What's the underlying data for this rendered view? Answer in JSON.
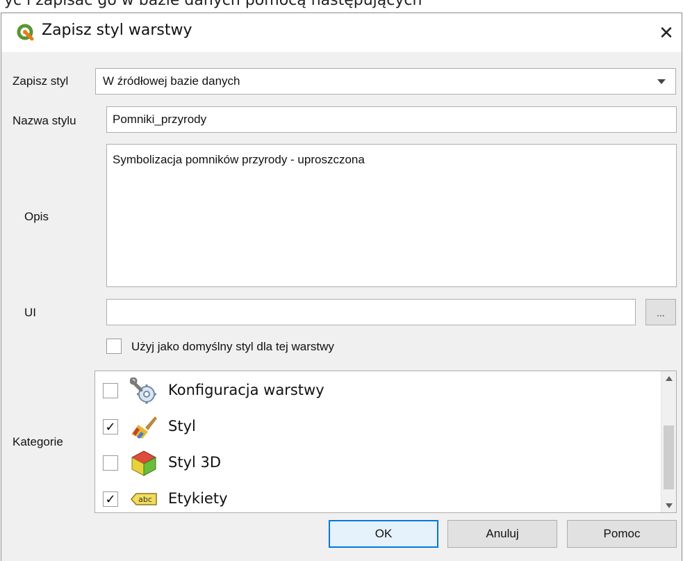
{
  "top_fragment": "yć i zapisać go w bazie danych pomocą następujących",
  "window": {
    "title": "Zapisz styl warstwy",
    "close_glyph": "✕",
    "app_icon": "qgis-logo-icon"
  },
  "form": {
    "save_style_label": "Zapisz styl",
    "save_style_value": "W źródłowej bazie danych",
    "style_name_label": "Nazwa stylu",
    "style_name_value": "Pomniki_przyrody",
    "description_label": "Opis",
    "description_value": "Symbolizacja pomników przyrody - uproszczona",
    "ui_label": "UI",
    "ui_value": "",
    "browse_label": "...",
    "default_checkbox_label": "Użyj jako domyślny styl dla tej warstwy",
    "default_checked": false,
    "categories_label": "Kategorie"
  },
  "categories": [
    {
      "label": "Konfiguracja warstwy",
      "checked": false,
      "icon": "wrench-gear-icon"
    },
    {
      "label": "Styl",
      "checked": true,
      "icon": "paintbrush-icon"
    },
    {
      "label": "Styl 3D",
      "checked": false,
      "icon": "cube-3d-icon"
    },
    {
      "label": "Etykiety",
      "checked": true,
      "icon": "abc-label-icon"
    }
  ],
  "checkmark": "✓",
  "buttons": {
    "ok": "OK",
    "cancel": "Anuluj",
    "help": "Pomoc"
  },
  "colors": {
    "accent": "#0078d7",
    "qgis_green": "#589632",
    "qgis_yellow": "#ee7913"
  }
}
